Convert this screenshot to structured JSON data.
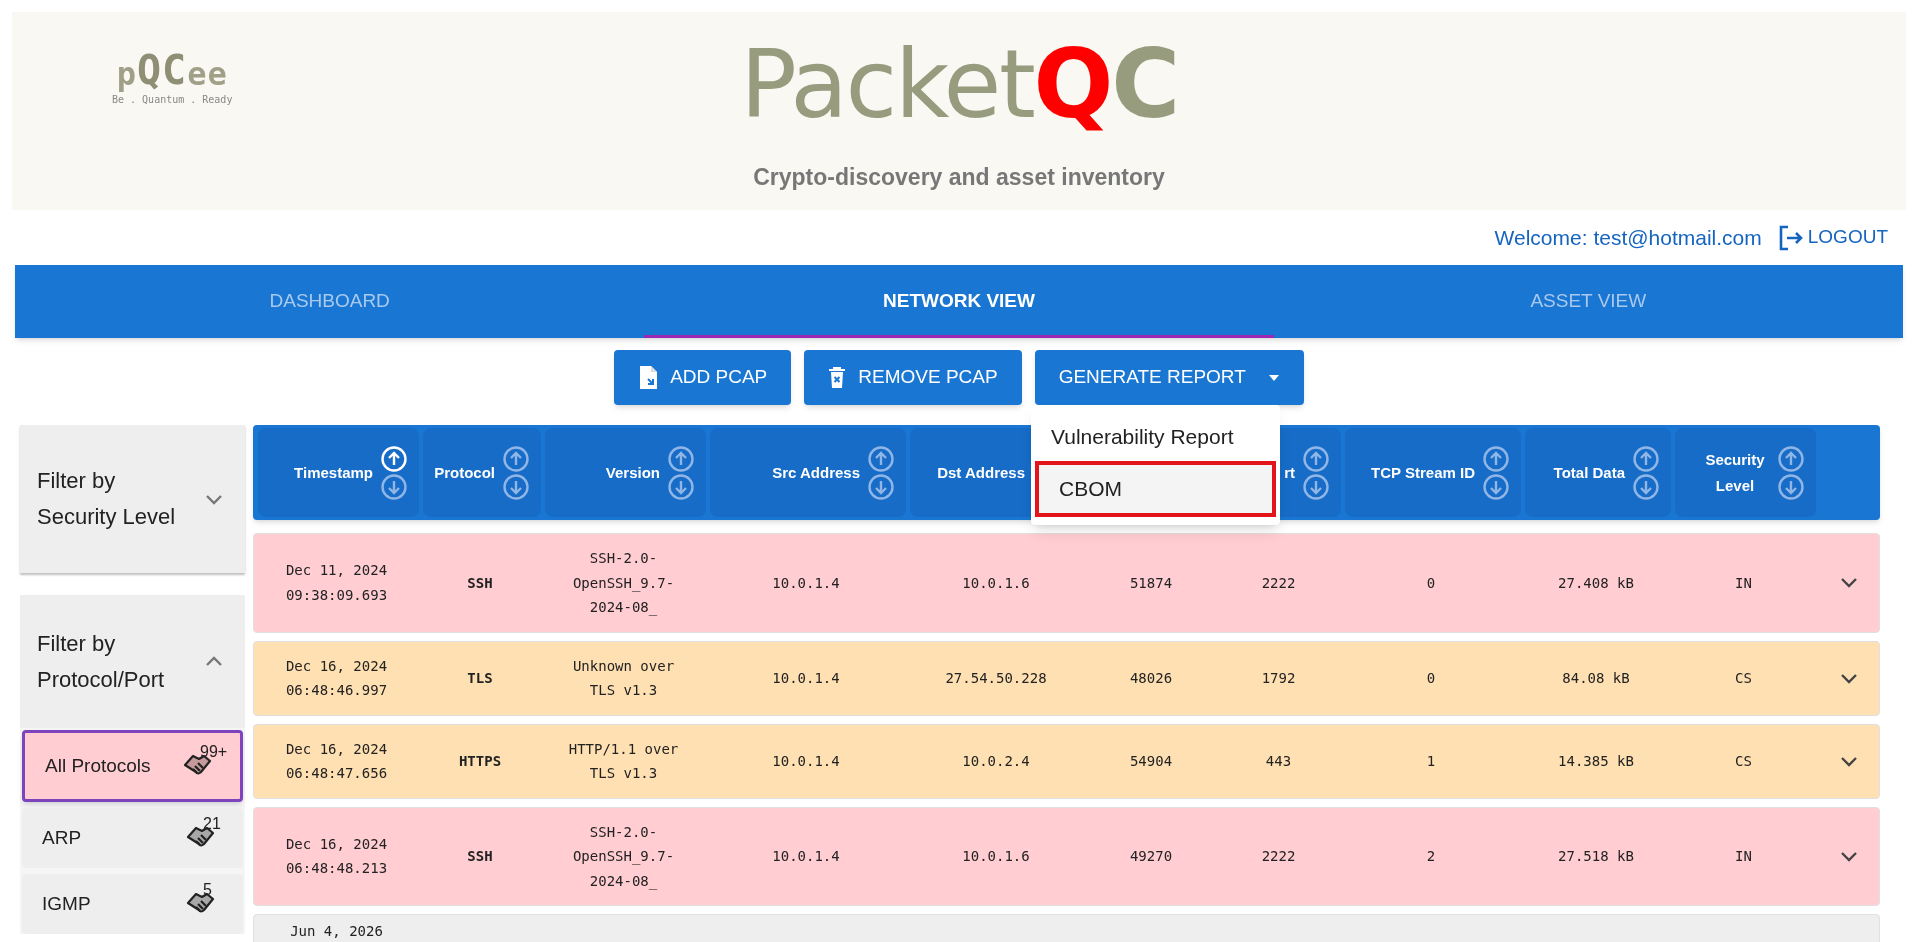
{
  "brand": {
    "logo_parts": [
      "p",
      "QC",
      "ee"
    ],
    "tagline": "Be . Quantum . Ready"
  },
  "header": {
    "title_parts": [
      "Packet",
      "Q",
      "C"
    ],
    "subtitle": "Crypto-discovery and asset inventory"
  },
  "user_bar": {
    "welcome": "Welcome: test@hotmail.com",
    "logout": "LOGOUT"
  },
  "tabs": [
    {
      "label": "DASHBOARD",
      "selected": false
    },
    {
      "label": "NETWORK VIEW",
      "selected": true
    },
    {
      "label": "ASSET VIEW",
      "selected": false
    }
  ],
  "toolbar": {
    "buttons": [
      {
        "label": "ADD PCAP",
        "kind": "add"
      },
      {
        "label": "REMOVE PCAP",
        "kind": "remove"
      },
      {
        "label": "GENERATE REPORT",
        "kind": "dropdown",
        "expanded": true
      }
    ]
  },
  "report_menu": {
    "items": [
      {
        "label": "Vulnerability Report",
        "highlighted": false
      },
      {
        "label": "CBOM",
        "highlighted": true
      }
    ]
  },
  "sidebar": {
    "sections": [
      {
        "title": "Filter by Security Level",
        "expanded": false
      },
      {
        "title": "Filter by Protocol/Port",
        "expanded": true,
        "items": [
          {
            "label": "All Protocols",
            "count": "99+",
            "selected": true
          },
          {
            "label": "ARP",
            "count": "21",
            "selected": false
          },
          {
            "label": "IGMP",
            "count": "5",
            "selected": false
          }
        ]
      }
    ]
  },
  "table": {
    "columns": [
      {
        "label": "Timestamp",
        "sorted_ascending": true
      },
      {
        "label": "Protocol",
        "sorted_ascending": false
      },
      {
        "label": "Version",
        "sorted_ascending": false
      },
      {
        "label": "Src Address",
        "sorted_ascending": false
      },
      {
        "label": "Dst Address"
      },
      {},
      {
        "label": "rt",
        "sorted_ascending": false
      },
      {
        "label": "TCP Stream ID",
        "sorted_ascending": false
      },
      {
        "label": "Total Data",
        "sorted_ascending": false
      },
      {
        "label": "Security Level",
        "sorted_ascending": false
      }
    ],
    "rows": [
      {
        "kind": "full",
        "color": "#ffcdd2",
        "cells": [
          "Dec 11, 2024 09:38:09.693",
          "SSH",
          "SSH-2.0-OpenSSH_9.7-2024-08_",
          "10.0.1.4",
          "10.0.1.6",
          "51874",
          "2222",
          "0",
          "27.408 kB",
          "IN"
        ]
      },
      {
        "kind": "full",
        "color": "#ffe0b2",
        "cells": [
          "Dec 16, 2024 06:48:46.997",
          "TLS",
          "Unknown over TLS v1.3",
          "10.0.1.4",
          "27.54.50.228",
          "48026",
          "1792",
          "0",
          "84.08 kB",
          "CS"
        ]
      },
      {
        "kind": "full",
        "color": "#ffe0b2",
        "cells": [
          "Dec 16, 2024 06:48:47.656",
          "HTTPS",
          "HTTP/1.1 over TLS v1.3",
          "10.0.1.4",
          "10.0.2.4",
          "54904",
          "443",
          "1",
          "14.385 kB",
          "CS"
        ]
      },
      {
        "kind": "full",
        "color": "#ffcdd2",
        "cells": [
          "Dec 16, 2024 06:48:48.213",
          "SSH",
          "SSH-2.0-OpenSSH_9.7-2024-08_",
          "10.0.1.4",
          "10.0.1.6",
          "49270",
          "2222",
          "2",
          "27.518 kB",
          "IN"
        ]
      },
      {
        "kind": "cut",
        "color": "#eeeeee",
        "cells": [
          "Jun 4, 2026"
        ]
      }
    ]
  }
}
